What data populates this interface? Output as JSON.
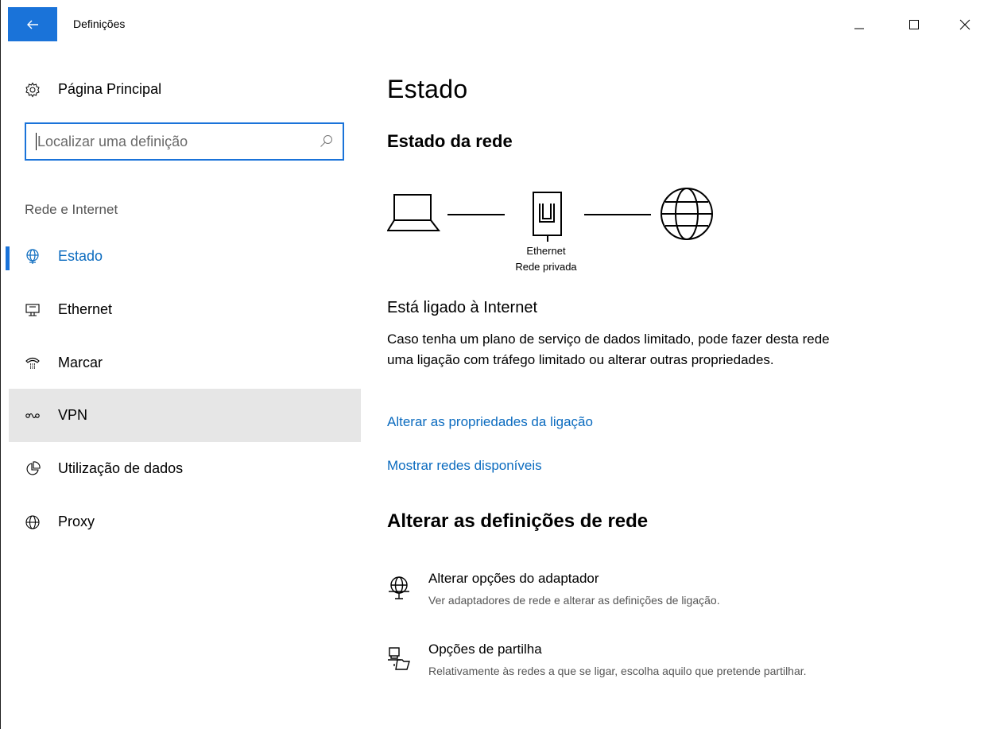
{
  "titlebar": {
    "title": "Definições",
    "back_icon": "back-arrow-icon",
    "minimize_icon": "minimize-icon",
    "maximize_icon": "maximize-icon",
    "close_icon": "close-icon",
    "accent_color": "#1a73d9"
  },
  "sidebar": {
    "home": {
      "label": "Página Principal",
      "icon": "gear-icon"
    },
    "search": {
      "placeholder": "Localizar uma definição",
      "value": "",
      "icon": "search-icon"
    },
    "section_label": "Rede e Internet",
    "items": [
      {
        "label": "Estado",
        "icon": "network-status-icon",
        "active": true
      },
      {
        "label": "Ethernet",
        "icon": "ethernet-icon",
        "active": false
      },
      {
        "label": "Marcar",
        "icon": "dialup-icon",
        "active": false
      },
      {
        "label": "VPN",
        "icon": "vpn-icon",
        "active": false,
        "hovered": true
      },
      {
        "label": "Utilização de dados",
        "icon": "data-usage-icon",
        "active": false
      },
      {
        "label": "Proxy",
        "icon": "globe-icon",
        "active": false
      }
    ]
  },
  "main": {
    "title": "Estado",
    "network_status_title": "Estado da rede",
    "diagram": {
      "computer_icon": "laptop-icon",
      "adapter_icon": "ethernet-port-icon",
      "internet_icon": "globe-icon",
      "connection_name": "Ethernet",
      "network_type": "Rede privada"
    },
    "connected_title": "Está ligado à Internet",
    "connected_desc": "Caso tenha um plano de serviço de dados limitado, pode fazer desta rede uma ligação com tráfego limitado ou alterar outras propriedades.",
    "link_properties": "Alterar as propriedades da ligação",
    "link_networks": "Mostrar redes disponíveis",
    "change_settings_title": "Alterar as definições de rede",
    "options": [
      {
        "title": "Alterar opções do adaptador",
        "desc": "Ver adaptadores de rede e alterar as definições de ligação.",
        "icon": "adapter-options-icon"
      },
      {
        "title": "Opções de partilha",
        "desc": "Relativamente às redes a que se ligar, escolha aquilo que pretende partilhar.",
        "icon": "sharing-options-icon"
      }
    ],
    "link_color": "#0b6bbf"
  }
}
